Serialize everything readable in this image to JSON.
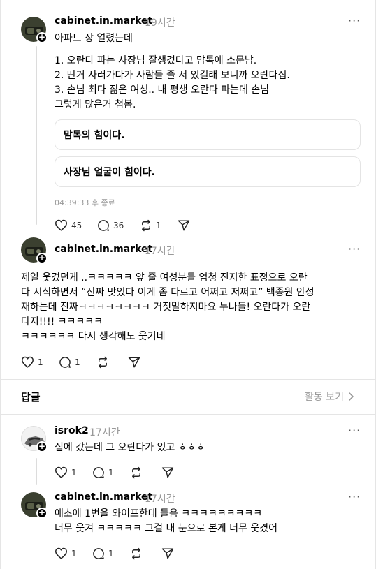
{
  "post": {
    "username": "cabinet.in.market",
    "time": "19시간",
    "title": "아파트 장 열렸는데",
    "lines": [
      "1. 오란다 파는 사장님 잘생겼다고 맘톡에 소문남.",
      "2. 딴거 사러가다가 사람들 줄 서 있길래 보니까 오란다집.",
      "3. 손님 최다 젊은 여성.. 내 평생 오란다 파는데 손님",
      "그렇게 많은거 첨봄."
    ],
    "quote_1": "맘톡의 힘이다.",
    "quote_2": "사장님 얼굴이 힘이다.",
    "ended": "04:39:33 후 종료",
    "likes": "45",
    "comments": "36",
    "reposts": "1"
  },
  "reply_1": {
    "username": "cabinet.in.market",
    "time": "17시간",
    "lines": [
      "제일 웃겼던게 ..ㅋㅋㅋㅋㅋ 앞 줄 여성분들 엄청 진지한 표정으로 오란",
      "다 시식하면서 “진짜 맛있다 이게 좀 다르고 어쩌고 저쩌고” 백종원 안성",
      "재하는데 진짜ㅋㅋㅋㅋㅋㅋㅋㅋ 거짓말하지마요 누나들! 오란다가 오란",
      "다지!!!! ㅋㅋㅋㅋㅋ",
      "ㅋㅋㅋㅋㅋㅋ 다시 생각해도 웃기네"
    ],
    "likes": "1",
    "comments": "1"
  },
  "replies_header": {
    "label": "답글",
    "activity_link": "활동 보기"
  },
  "comment_1": {
    "username": "isrok2",
    "time": "17시간",
    "text": "집에 갔는데 그 오란다가 있고 ㅎㅎㅎ",
    "likes": "1",
    "comments": "1"
  },
  "comment_2": {
    "username": "cabinet.in.market",
    "time": "17시간",
    "lines": [
      "애초에 1번을 와이프한테 들음 ㅋㅋㅋㅋㅋㅋㅋㅋㅋ",
      "너무 웃겨 ㅋㅋㅋㅋㅋ 그걸 내 눈으로 본게 너무 웃겼어"
    ],
    "likes": "1",
    "comments": "1"
  },
  "icons": {
    "like": "heart-icon",
    "comment": "comment-bubble-icon",
    "repost": "repost-icon",
    "share": "share-send-icon",
    "more": "more-dots-icon",
    "follow": "plus-icon"
  },
  "colors": {
    "muted_text": "#999999",
    "border": "#e4e4e4",
    "thread_line": "#dcdcdc"
  }
}
